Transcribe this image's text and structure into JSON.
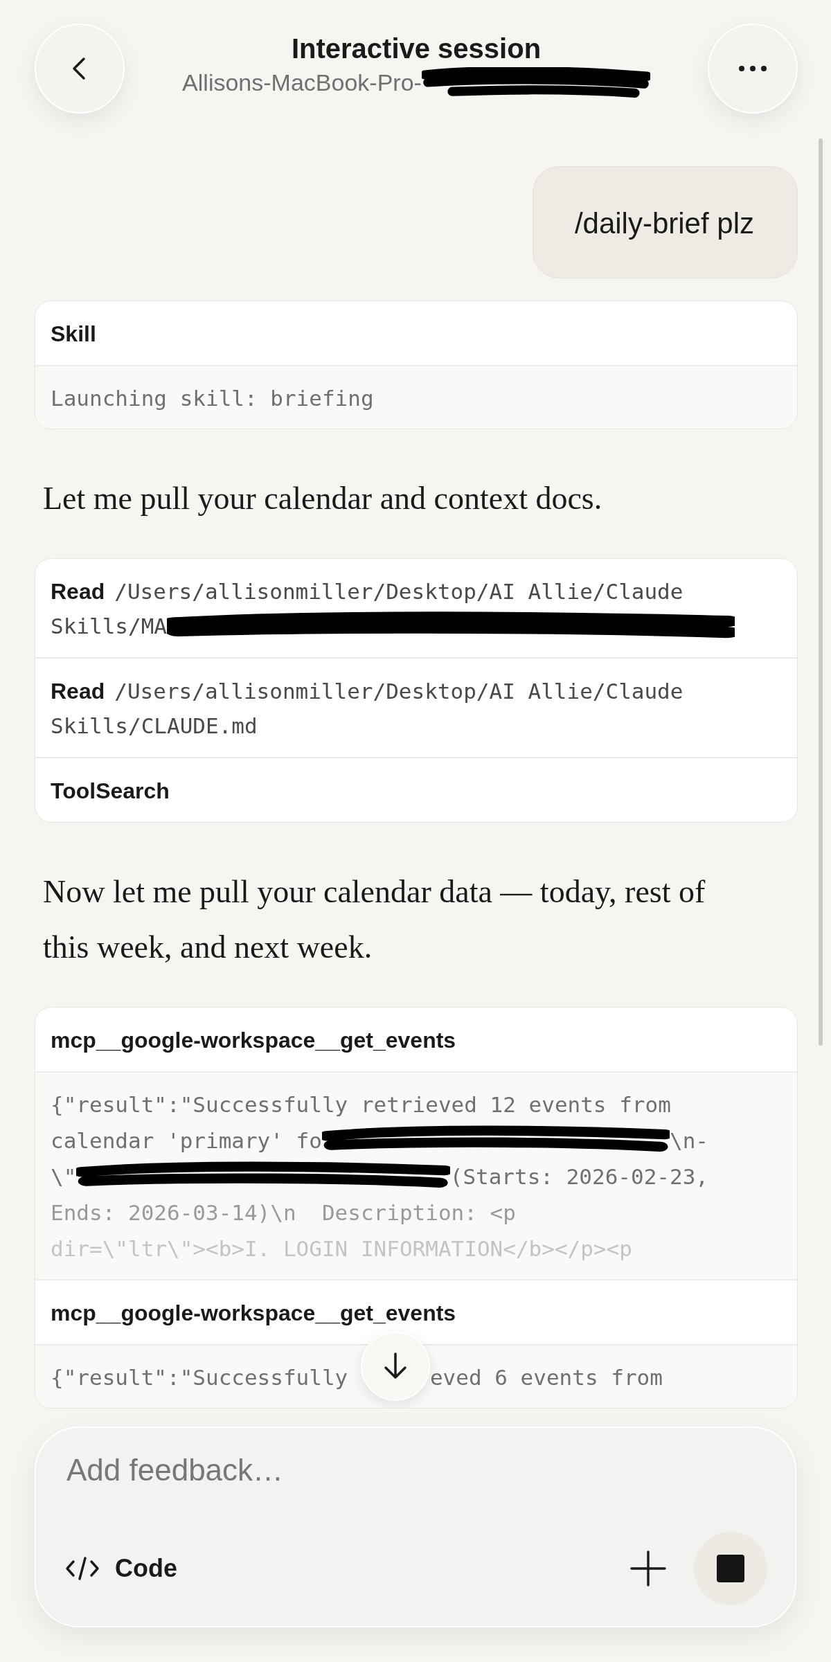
{
  "header": {
    "title": "Interactive session",
    "subtitle": "Allisons-MacBook-Pro-",
    "subtitle_redacted": true
  },
  "messages": [
    {
      "kind": "user",
      "text": "/daily-brief plz"
    },
    {
      "kind": "tools",
      "items": [
        {
          "name": "Skill",
          "output_lines": [
            [
              {
                "kind": "text",
                "text": "Launching skill: briefing"
              }
            ]
          ]
        }
      ]
    },
    {
      "kind": "assistant",
      "text": "Let me pull your calendar and context docs."
    },
    {
      "kind": "tools",
      "items": [
        {
          "name": "Read",
          "path_lines": [
            "/Users/allisonmiller/Desktop/AI Allie/Claude",
            "Skills/MA"
          ],
          "path_redacted": true
        },
        {
          "name": "Read",
          "path_lines": [
            "/Users/allisonmiller/Desktop/AI Allie/Claude",
            "Skills/CLAUDE.md"
          ],
          "path_redacted": false
        },
        {
          "name": "ToolSearch"
        }
      ]
    },
    {
      "kind": "assistant",
      "text": "Now let me pull your calendar data — today, rest of this week, and next week."
    },
    {
      "kind": "tools",
      "items": [
        {
          "name": "mcp__google-workspace__get_events",
          "output_lines": [
            [
              {
                "kind": "text",
                "text": "{\"result\":\"Successfully retrieved 12 events from"
              }
            ],
            [
              {
                "kind": "text",
                "text": "calendar 'primary' fo"
              },
              {
                "kind": "redaction"
              },
              {
                "kind": "text",
                "text": "\\n-"
              }
            ],
            [
              {
                "kind": "text",
                "text": "\\\""
              },
              {
                "kind": "redaction"
              },
              {
                "kind": "text",
                "text": "(Starts: 2026-02-23,"
              }
            ],
            [
              {
                "kind": "text",
                "text": "Ends: 2026-03-14)\\n  Description: <p"
              }
            ],
            [
              {
                "kind": "text",
                "text": "dir=\\\"ltr\\\"><b>I. LOGIN INFORMATION</b></p><p"
              }
            ]
          ]
        },
        {
          "name": "mcp__google-workspace__get_events",
          "output_lines": [
            [
              {
                "kind": "text",
                "text": "{\"result\":\"Successfully "
              },
              {
                "kind": "covered"
              },
              {
                "kind": "text",
                "text": "eved 6 events from"
              }
            ]
          ]
        }
      ]
    }
  ],
  "composer": {
    "placeholder": "Add feedback…",
    "mode": "Code"
  }
}
